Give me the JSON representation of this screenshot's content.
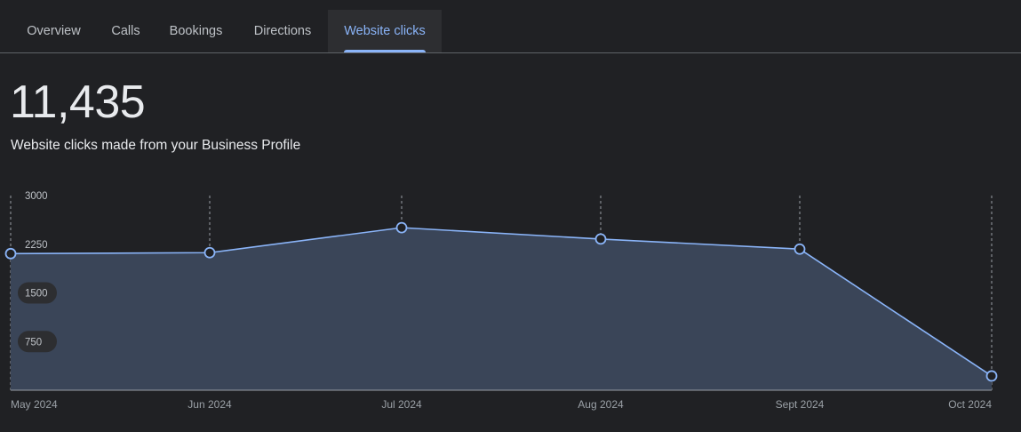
{
  "tabs": [
    {
      "label": "Overview",
      "active": false
    },
    {
      "label": "Calls",
      "active": false
    },
    {
      "label": "Bookings",
      "active": false
    },
    {
      "label": "Directions",
      "active": false
    },
    {
      "label": "Website clicks",
      "active": true
    }
  ],
  "metric": {
    "value": "11,435",
    "description": "Website clicks made from your Business Profile"
  },
  "colors": {
    "background": "#202124",
    "accent": "#8ab4f8",
    "area_fill": "#3a4558"
  },
  "chart_data": {
    "type": "area",
    "categories": [
      "May 2024",
      "Jun 2024",
      "Jul 2024",
      "Aug 2024",
      "Sept 2024",
      "Oct 2024"
    ],
    "values": [
      2105,
      2120,
      2505,
      2330,
      2175,
      220
    ],
    "y_ticks": [
      3000,
      2250,
      1500,
      750
    ],
    "ylim": [
      0,
      3000
    ],
    "grid": "vertical-dashed",
    "marker": "hollow-circle"
  }
}
